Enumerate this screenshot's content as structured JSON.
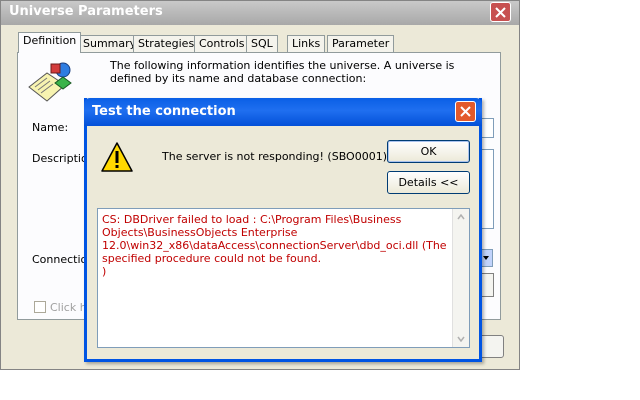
{
  "outer_window": {
    "title": "Universe Parameters",
    "tabs": [
      {
        "label": "Definition",
        "active": true
      },
      {
        "label": "Summary",
        "active": false
      },
      {
        "label": "Strategies",
        "active": false
      },
      {
        "label": "Controls",
        "active": false
      },
      {
        "label": "SQL",
        "active": false
      },
      {
        "label": "Links",
        "active": false
      },
      {
        "label": "Parameter",
        "active": false
      }
    ],
    "info_text": "The following information identifies the universe. A universe is defined by its name and database connection:",
    "name_label": "Name:",
    "description_label": "Description",
    "connection_label": "Connection",
    "checkbox_label": "Click he"
  },
  "dialog": {
    "title": "Test the connection",
    "message": "The server is not responding! (SBO0001)",
    "ok_label": "OK",
    "details_label": "Details <<",
    "details_text": "CS: DBDriver failed to load : C:\\Program Files\\Business Objects\\BusinessObjects Enterprise 12.0\\win32_x86\\dataAccess\\connectionServer\\dbd_oci.dll (The specified procedure could not be found.\n)"
  },
  "colors": {
    "dialog_title_blue": "#0054e3",
    "error_text_red": "#c00000",
    "warning_yellow": "#ffd800"
  },
  "icons": {
    "universe": "universe-icon",
    "warning": "warning-icon",
    "close": "close-icon"
  }
}
